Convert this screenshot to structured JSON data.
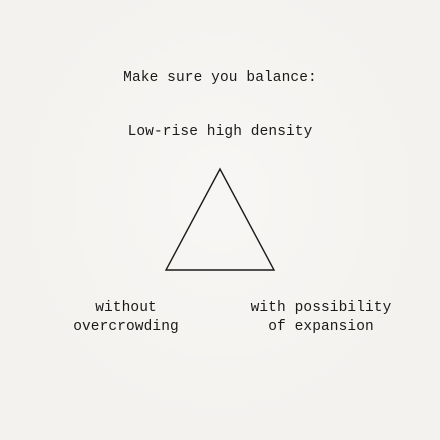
{
  "heading": "Make sure you balance:",
  "diagram": {
    "vertices": {
      "top": "Low-rise high density",
      "bottom_left": [
        "without",
        "overcrowding"
      ],
      "bottom_right": [
        "with possibility",
        "of expansion"
      ]
    },
    "stroke_color": "#1a1a1a"
  }
}
